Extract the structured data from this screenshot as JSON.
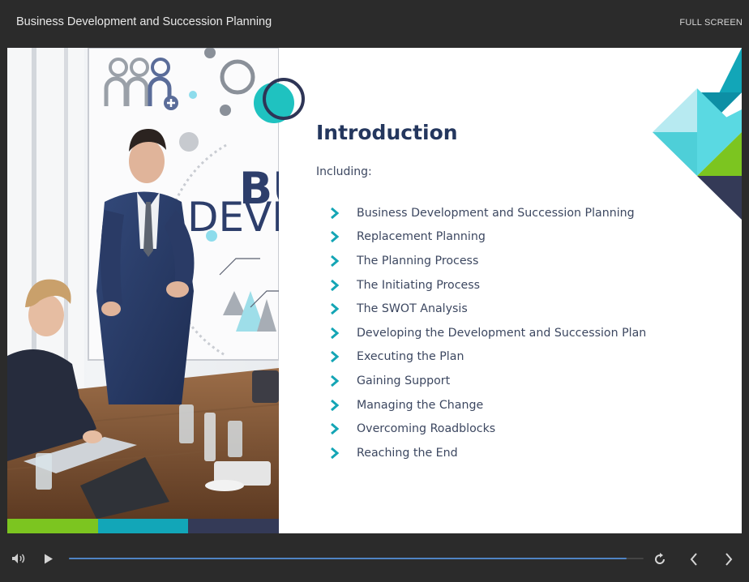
{
  "header": {
    "course_title": "Business Development and Succession Planning",
    "fullscreen_label": "FULL SCREEN"
  },
  "slide": {
    "heading": "Introduction",
    "subheading": "Including:",
    "items": [
      {
        "label": "Business Development and Succession Planning"
      },
      {
        "label": "Replacement Planning"
      },
      {
        "label": "The Planning Process"
      },
      {
        "label": "The Initiating Process"
      },
      {
        "label": "The SWOT Analysis"
      },
      {
        "label": "Developing the Development and Succession Plan"
      },
      {
        "label": "Executing the Plan"
      },
      {
        "label": "Gaining Support"
      },
      {
        "label": "Managing the Change"
      },
      {
        "label": "Overcoming Roadblocks"
      },
      {
        "label": "Reaching the End"
      }
    ],
    "photo": {
      "board_text_line1": "BU",
      "board_text_line2": "DEVE"
    },
    "colors": {
      "heading": "#24375e",
      "text": "#3c4760",
      "chevron": "#14a5b5",
      "strip_green": "#7cc520",
      "strip_teal": "#12a6b8",
      "strip_navy": "#343a57"
    }
  },
  "controls": {
    "volume_icon": "volume-icon",
    "play_icon": "play-icon",
    "replay_icon": "replay-icon",
    "prev_icon": "prev-icon",
    "next_icon": "next-icon",
    "progress": 0.97
  }
}
